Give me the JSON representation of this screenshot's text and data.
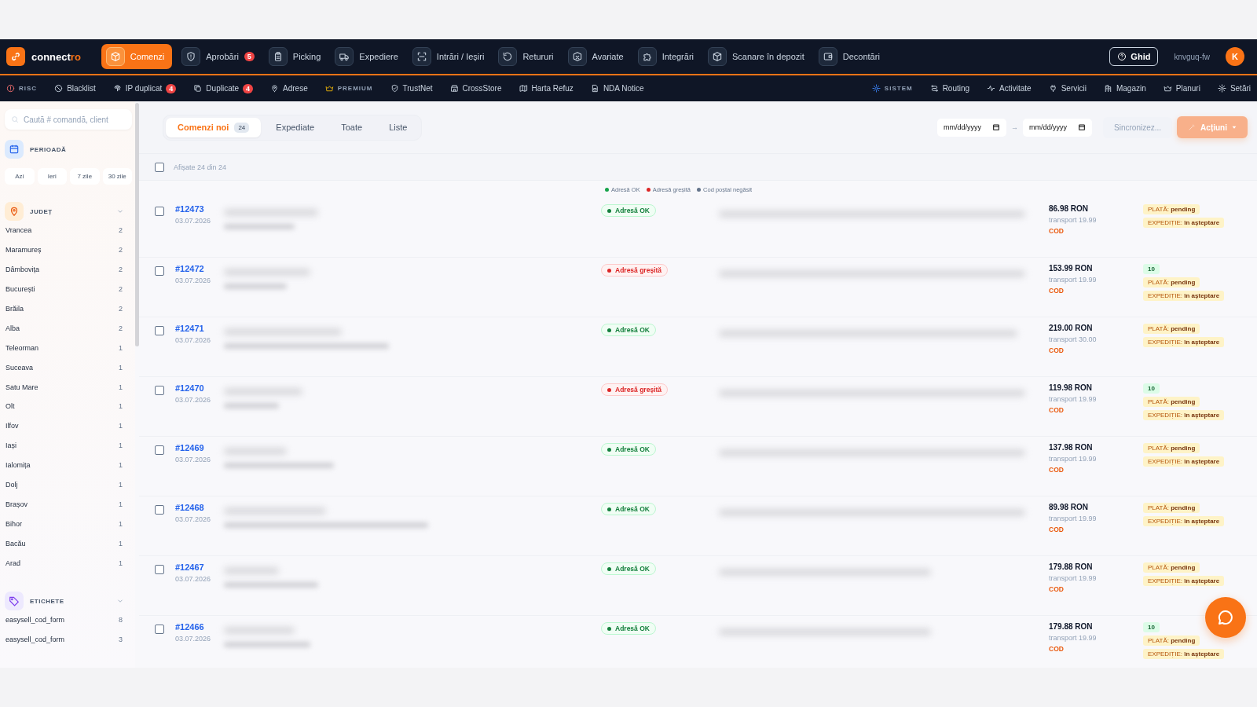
{
  "brand": {
    "name_main": "connect",
    "name_accent": "ro"
  },
  "nav": [
    {
      "label": "Comenzi",
      "selected": true
    },
    {
      "label": "Aprobări",
      "selected": false,
      "badge": "5"
    },
    {
      "label": "Picking",
      "selected": false
    },
    {
      "label": "Expediere",
      "selected": false
    },
    {
      "label": "Intrări / Ieșiri",
      "selected": false
    },
    {
      "label": "Retururi",
      "selected": false
    },
    {
      "label": "Avariate",
      "selected": false
    },
    {
      "label": "Integrări",
      "selected": false
    },
    {
      "label": "Scanare în depozit",
      "selected": false
    },
    {
      "label": "Decontări",
      "selected": false
    }
  ],
  "user": {
    "guide": "Ghid",
    "workspace": "knvguq-fw",
    "avatar": "K"
  },
  "subnav_left": [
    {
      "label": "RISC",
      "kind": "section"
    },
    {
      "label": "Blacklist",
      "kind": "link"
    },
    {
      "label": "IP duplicat",
      "kind": "link",
      "badge": "4"
    },
    {
      "label": "Duplicate",
      "kind": "link",
      "badge": "4"
    },
    {
      "label": "Adrese",
      "kind": "link"
    },
    {
      "label": "PREMIUM",
      "kind": "premium"
    },
    {
      "label": "TrustNet",
      "kind": "link"
    },
    {
      "label": "CrossStore",
      "kind": "link"
    },
    {
      "label": "Harta Refuz",
      "kind": "link"
    },
    {
      "label": "NDA Notice",
      "kind": "link"
    }
  ],
  "subnav_right": [
    {
      "label": "SISTEM",
      "kind": "system"
    },
    {
      "label": "Routing",
      "kind": "link"
    },
    {
      "label": "Activitate",
      "kind": "link"
    },
    {
      "label": "Servicii",
      "kind": "link"
    },
    {
      "label": "Magazin",
      "kind": "link"
    },
    {
      "label": "Planuri",
      "kind": "link"
    },
    {
      "label": "Setări",
      "kind": "link"
    }
  ],
  "sidebar": {
    "search": {
      "placeholder": "Caută # comandă, client"
    },
    "period": {
      "title": "PERIOADĂ",
      "presets": [
        "Azi",
        "Ieri",
        "7 zile",
        "30 zile"
      ]
    },
    "county": {
      "title": "JUDEȚ",
      "expanded": true,
      "items": [
        {
          "name": "Vrancea",
          "count": "2"
        },
        {
          "name": "Maramureș",
          "count": "2"
        },
        {
          "name": "Dâmbovița",
          "count": "2"
        },
        {
          "name": "București",
          "count": "2"
        },
        {
          "name": "Brăila",
          "count": "2"
        },
        {
          "name": "Alba",
          "count": "2"
        },
        {
          "name": "Teleorman",
          "count": "1"
        },
        {
          "name": "Suceava",
          "count": "1"
        },
        {
          "name": "Satu Mare",
          "count": "1"
        },
        {
          "name": "Olt",
          "count": "1"
        },
        {
          "name": "Ilfov",
          "count": "1"
        },
        {
          "name": "Iași",
          "count": "1"
        },
        {
          "name": "Ialomița",
          "count": "1"
        },
        {
          "name": "Dolj",
          "count": "1"
        },
        {
          "name": "Brașov",
          "count": "1"
        },
        {
          "name": "Bihor",
          "count": "1"
        },
        {
          "name": "Bacău",
          "count": "1"
        },
        {
          "name": "Arad",
          "count": "1"
        }
      ]
    },
    "labels": {
      "title": "ETICHETE",
      "expanded": true,
      "items": [
        {
          "name": "easysell_cod_form",
          "count": "8"
        },
        {
          "name": "easysell_cod_form",
          "count": "3"
        }
      ]
    }
  },
  "tabs": [
    {
      "label": "Comenzi noi",
      "count": "24",
      "selected": true
    },
    {
      "label": "Expediate",
      "selected": false
    },
    {
      "label": "Toate",
      "selected": false
    },
    {
      "label": "Liste",
      "selected": false
    }
  ],
  "date_from": {
    "placeholder": "mm/dd/yyyy"
  },
  "date_separator": "→",
  "date_to": {
    "placeholder": "mm/dd/yyyy"
  },
  "sync_button": "Sincronizez...",
  "actions_button": "Acțiuni",
  "list_header": {
    "checked": false,
    "summary": "Afișate 24 din 24"
  },
  "legend": [
    {
      "label": "Adresă OK",
      "color": "#16a34a"
    },
    {
      "label": "Adresă greșită",
      "color": "#dc2626"
    },
    {
      "label": "Cod poștal negăsit",
      "color": "#64748b"
    }
  ],
  "orders": [
    {
      "number": "#12473",
      "date": "03.07.2026",
      "checked": false,
      "address": {
        "label": "Adresă OK",
        "kind": "ok"
      },
      "total": "86.98 RON",
      "transport": "transport 19.99",
      "method": "COD",
      "payment": {
        "label": "PLATĂ:",
        "value": "pending"
      },
      "shipping": {
        "label": "EXPEDIȚIE:",
        "value": "în așteptare"
      }
    },
    {
      "number": "#12472",
      "date": "03.07.2026",
      "checked": false,
      "address": {
        "label": "Adresă greșită",
        "kind": "bad"
      },
      "total": "153.99 RON",
      "transport": "transport 19.99",
      "method": "COD",
      "tag": "10",
      "payment": {
        "label": "PLATĂ:",
        "value": "pending"
      },
      "shipping": {
        "label": "EXPEDIȚIE:",
        "value": "în așteptare"
      }
    },
    {
      "number": "#12471",
      "date": "03.07.2026",
      "checked": false,
      "address": {
        "label": "Adresă OK",
        "kind": "ok"
      },
      "total": "219.00 RON",
      "transport": "transport 30.00",
      "method": "COD",
      "payment": {
        "label": "PLATĂ:",
        "value": "pending"
      },
      "shipping": {
        "label": "EXPEDIȚIE:",
        "value": "în așteptare"
      }
    },
    {
      "number": "#12470",
      "date": "03.07.2026",
      "checked": false,
      "address": {
        "label": "Adresă greșită",
        "kind": "bad"
      },
      "total": "119.98 RON",
      "transport": "transport 19.99",
      "method": "COD",
      "tag": "10",
      "payment": {
        "label": "PLATĂ:",
        "value": "pending"
      },
      "shipping": {
        "label": "EXPEDIȚIE:",
        "value": "în așteptare"
      }
    },
    {
      "number": "#12469",
      "date": "03.07.2026",
      "checked": false,
      "address": {
        "label": "Adresă OK",
        "kind": "ok"
      },
      "total": "137.98 RON",
      "transport": "transport 19.99",
      "method": "COD",
      "payment": {
        "label": "PLATĂ:",
        "value": "pending"
      },
      "shipping": {
        "label": "EXPEDIȚIE:",
        "value": "în așteptare"
      }
    },
    {
      "number": "#12468",
      "date": "03.07.2026",
      "checked": false,
      "address": {
        "label": "Adresă OK",
        "kind": "ok"
      },
      "total": "89.98 RON",
      "transport": "transport 19.99",
      "method": "COD",
      "payment": {
        "label": "PLATĂ:",
        "value": "pending"
      },
      "shipping": {
        "label": "EXPEDIȚIE:",
        "value": "în așteptare"
      }
    },
    {
      "number": "#12467",
      "date": "03.07.2026",
      "checked": false,
      "address": {
        "label": "Adresă OK",
        "kind": "ok"
      },
      "total": "179.88 RON",
      "transport": "transport 19.99",
      "method": "COD",
      "payment": {
        "label": "PLATĂ:",
        "value": "pending"
      },
      "shipping": {
        "label": "EXPEDIȚIE:",
        "value": "în așteptare"
      }
    },
    {
      "number": "#12466",
      "date": "03.07.2026",
      "checked": false,
      "address": {
        "label": "Adresă OK",
        "kind": "ok"
      },
      "total": "179.88 RON",
      "transport": "transport 19.99",
      "method": "COD",
      "tag": "10",
      "payment": {
        "label": "PLATĂ:",
        "value": "pending"
      },
      "shipping": {
        "label": "EXPEDIȚIE:",
        "value": "în așteptare"
      }
    }
  ]
}
